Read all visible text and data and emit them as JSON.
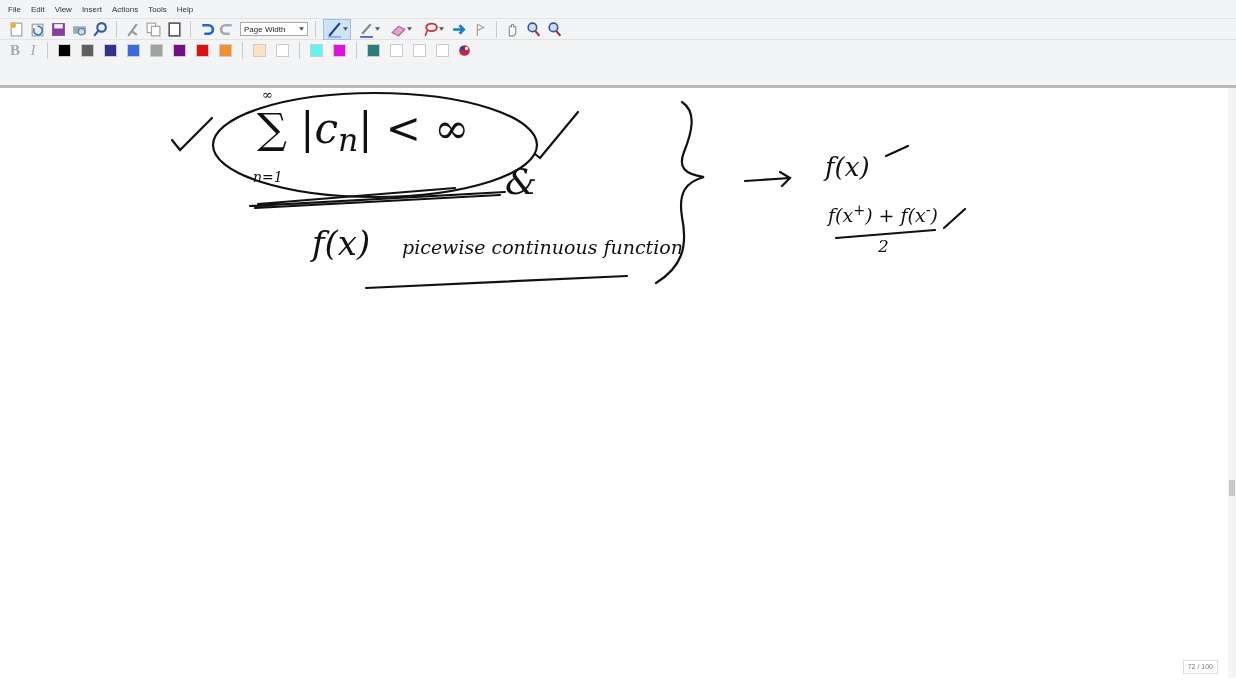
{
  "menu": [
    "File",
    "Edit",
    "View",
    "Insert",
    "Actions",
    "Tools",
    "Help"
  ],
  "zoom_select": {
    "value": "Page Width"
  },
  "tools": [
    {
      "kind": "pen",
      "selected": true
    },
    {
      "kind": "highlighter",
      "selected": false
    },
    {
      "kind": "eraser",
      "selected": false
    },
    {
      "kind": "lasso",
      "selected": false
    }
  ],
  "format": [
    "B",
    "I"
  ],
  "colors": [
    {
      "color": "#000000"
    },
    {
      "color": "#606060"
    },
    {
      "color": "#303090"
    },
    {
      "color": "#3a6be0"
    },
    {
      "color": "#a0a4a0"
    },
    {
      "color": "#7a0a8a"
    },
    {
      "color": "#e01010"
    },
    {
      "color": "#f09030"
    },
    {
      "color": "#fde4c0"
    },
    {
      "color": "#ffffff"
    },
    {
      "color": "#60f5f0"
    },
    {
      "color": "#e010e0"
    },
    {
      "color": "#2a8078"
    },
    {
      "color": "#ffffff"
    },
    {
      "color": "#ffffff"
    },
    {
      "color": "#ffffff"
    }
  ],
  "ink_texts": [
    "∞",
    "∑ |c$_{n}$| < ∞",
    "n=1",
    "&",
    "f(x)",
    "picewise continuous function",
    "f(x)",
    "f(x$^{+}$) + f(x$^{-}$)",
    "2"
  ],
  "page_indicator": "72 / 100"
}
